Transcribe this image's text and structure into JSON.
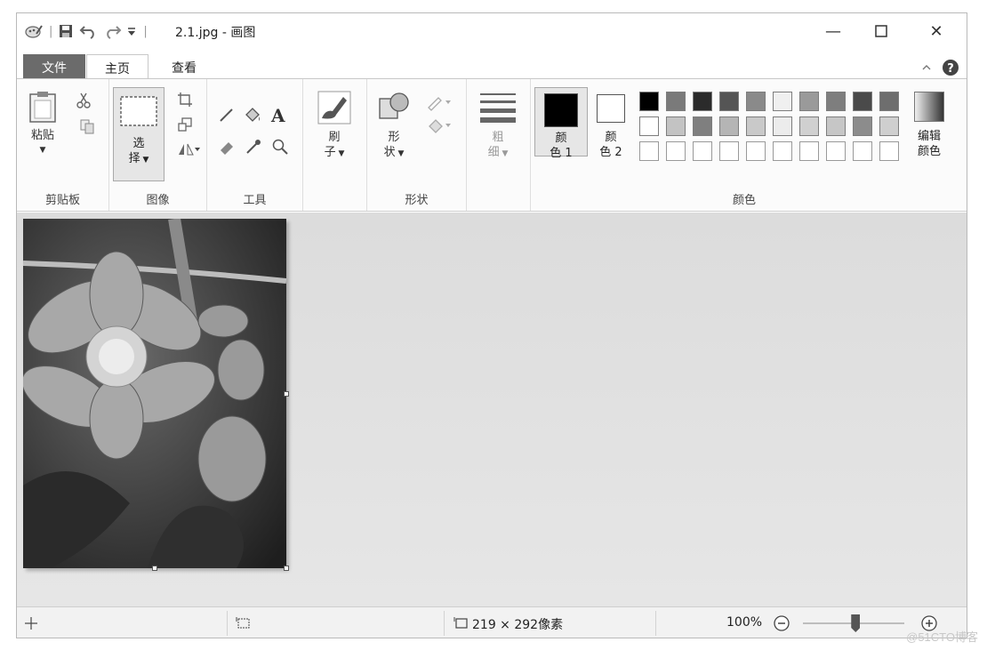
{
  "window": {
    "title": "2.1.jpg - 画图",
    "minimize": "—",
    "close": "✕"
  },
  "tabs": {
    "file": "文件",
    "home": "主页",
    "view": "查看"
  },
  "ribbon": {
    "clipboard": {
      "paste": "粘贴",
      "group": "剪贴板"
    },
    "image": {
      "select_1": "选",
      "select_2": "择",
      "group": "图像"
    },
    "tools": {
      "text_glyph": "A",
      "group": "工具"
    },
    "brush": {
      "label_1": "刷",
      "label_2": "子"
    },
    "shapes": {
      "label_1": "形",
      "label_2": "状",
      "group": "形状"
    },
    "size": {
      "label_1": "粗",
      "label_2": "细"
    },
    "colors": {
      "color1_1": "颜",
      "color1_2": "色 1",
      "color2_1": "颜",
      "color2_2": "色 2",
      "edit_1": "编辑",
      "edit_2": "颜色",
      "group": "颜色",
      "color1_value": "#000000",
      "color2_value": "#ffffff",
      "palette_row1": [
        "#000000",
        "#7a7a7a",
        "#2b2b2b",
        "#555555",
        "#8a8a8a",
        "#f0f0f0",
        "#9a9a9a",
        "#7e7e7e",
        "#4a4a4a",
        "#6e6e6e"
      ],
      "palette_row2": [
        "#ffffff",
        "#c3c3c3",
        "#7f7f7f",
        "#b5b5b5",
        "#c9c9c9",
        "#ececec",
        "#d0d0d0",
        "#c6c6c6",
        "#8c8c8c",
        "#cfcfcf"
      ],
      "palette_row3": [
        "#ffffff",
        "#ffffff",
        "#ffffff",
        "#ffffff",
        "#ffffff",
        "#ffffff",
        "#ffffff",
        "#ffffff",
        "#ffffff",
        "#ffffff"
      ]
    }
  },
  "status": {
    "selection_size": "219 × 292像素",
    "zoom": "100%",
    "zoom_level_percent": 100
  },
  "watermark": "@51CTO博客"
}
